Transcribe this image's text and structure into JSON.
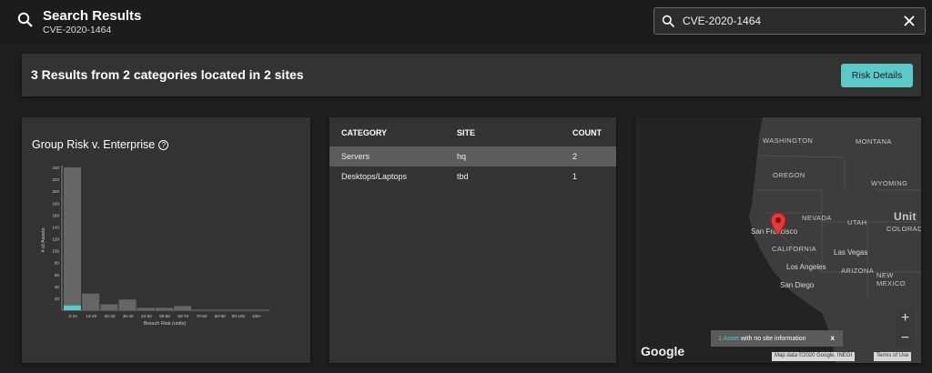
{
  "header": {
    "title": "Search Results",
    "subtitle": "CVE-2020-1464",
    "search_value": "CVE-2020-1464"
  },
  "banner": {
    "summary": "3 Results from 2 categories located in 2 sites",
    "risk_button": "Risk Details"
  },
  "chart": {
    "title": "Group Risk v. Enterprise",
    "help": "?"
  },
  "chart_data": {
    "type": "bar",
    "xlabel": "Breach Risk (units)",
    "ylabel": "# of Assets",
    "categories": [
      "0-10",
      "10-20",
      "20-30",
      "30-40",
      "40-50",
      "50-60",
      "60-70",
      "70-80",
      "80-90",
      "90-100",
      "100+"
    ],
    "series": [
      {
        "values": [
          240,
          28,
          10,
          18,
          4,
          4,
          7,
          0,
          0,
          0,
          0
        ]
      },
      {
        "values": [
          8,
          0,
          0,
          0,
          0,
          0,
          0,
          0,
          0,
          0,
          0
        ]
      }
    ],
    "yticks": [
      "240",
      "220",
      "200",
      "180",
      "160",
      "140",
      "120",
      "100",
      "80",
      "60",
      "40",
      "20"
    ],
    "colors": {
      "enterprise": "#666666",
      "group": "#5ac9c7"
    }
  },
  "table": {
    "headers": {
      "category": "CATEGORY",
      "site": "SITE",
      "count": "COUNT"
    },
    "rows": [
      {
        "category": "Servers",
        "site": "hq",
        "count": "2"
      },
      {
        "category": "Desktops/Laptops",
        "site": "tbd",
        "count": "1"
      }
    ]
  },
  "map": {
    "states": {
      "washington": "WASHINGTON",
      "montana": "MONTANA",
      "oregon": "OREGON",
      "wyoming": "WYOMING",
      "nevada": "NEVADA",
      "utah": "UTAH",
      "california": "CALIFORNIA",
      "arizona": "ARIZONA",
      "colorado": "COLORADO",
      "new_mexico": "NEW MEXICO",
      "united": "Unit"
    },
    "cities": {
      "sf": "San Francisco",
      "las_vegas": "Las Vegas",
      "los_angeles": "Los Angeles",
      "san_diego": "San Diego"
    },
    "toast_link": "1 Asset",
    "toast_text": "with no site information",
    "toast_close": "x",
    "zoom_in": "+",
    "zoom_out": "−",
    "google": "Google",
    "attribution": "Map data ©2020 Google, INEGI",
    "terms": "Terms of Use"
  }
}
